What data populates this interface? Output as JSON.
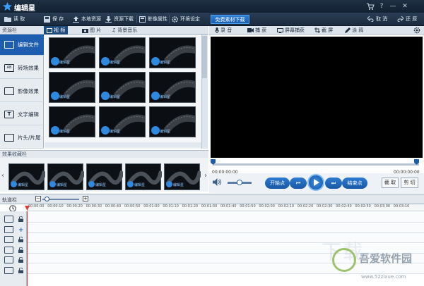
{
  "app": {
    "title": "编辑星"
  },
  "window": {
    "icons": [
      "cart-icon",
      "help-icon",
      "minimize-icon",
      "close-icon"
    ]
  },
  "toolbar": {
    "open": "读 取",
    "save": "保 存",
    "local": "本地资源",
    "download": "资源下载",
    "props": "影像属性",
    "settings": "环境设定",
    "free_download": "免费素材下载",
    "undo": "取 消",
    "redo": "还 原"
  },
  "resource": {
    "header": "资源栏",
    "tabs": [
      "视 频",
      "图 片",
      "背景音乐"
    ]
  },
  "sidebar": {
    "items": [
      "编辑文件",
      "转场效果",
      "影像效果",
      "文字编辑",
      "片头/片尾"
    ]
  },
  "thumbs": {
    "label": "编辑星"
  },
  "effects": {
    "header": "效果收藏栏"
  },
  "recorder": {
    "tools": [
      "录 音",
      "捕 获",
      "屏幕捕获",
      "截 屏",
      "涂 鸦"
    ]
  },
  "player": {
    "time_start": "00:00:00:00",
    "time_end": "00:00:00:00",
    "start_point": "开始点",
    "end_point": "结束点",
    "cut": "截 取",
    "clip": "剪 切"
  },
  "timeline": {
    "header": "轨道栏",
    "ticks": [
      "00:00:00",
      "00:00:10",
      "00:00:20",
      "00:00:30",
      "00:00:40",
      "00:00:50",
      "00:01:00",
      "00:01:10",
      "00:01:20",
      "00:01:30",
      "00:01:40",
      "00:01:50",
      "00:02:00",
      "00:02:10",
      "00:02:20",
      "00:02:30",
      "00:02:40",
      "00:02:50",
      "00:03:00",
      "00:03:10"
    ]
  },
  "watermark": {
    "site": "吾爱软件园",
    "url": "www.52zixue.com",
    "big": "下载"
  },
  "colors": {
    "accent": "#1d5eb0",
    "titlebar": "#1e2f43",
    "playhead": "#e03b3b"
  }
}
